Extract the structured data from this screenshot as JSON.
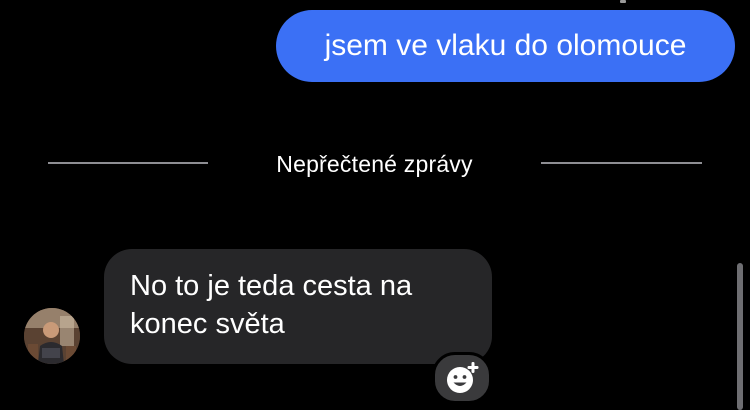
{
  "chat": {
    "outgoing_message": {
      "text": "jsem ve vlaku do olomouce"
    },
    "unread_divider": {
      "label": "Nepřečtené zprávy"
    },
    "incoming_message": {
      "text_line_1": "No to je teda cesta na",
      "text_line_2": "konec světa"
    }
  },
  "icons": {
    "avatar": "contact-avatar-photo",
    "reaction": "add-reaction-smiley-icon"
  },
  "colors": {
    "background": "#000000",
    "outgoing_bubble": "#3b70f5",
    "incoming_bubble": "#262628",
    "divider": "#8e8e93",
    "reaction_button": "#3a3a3c"
  }
}
